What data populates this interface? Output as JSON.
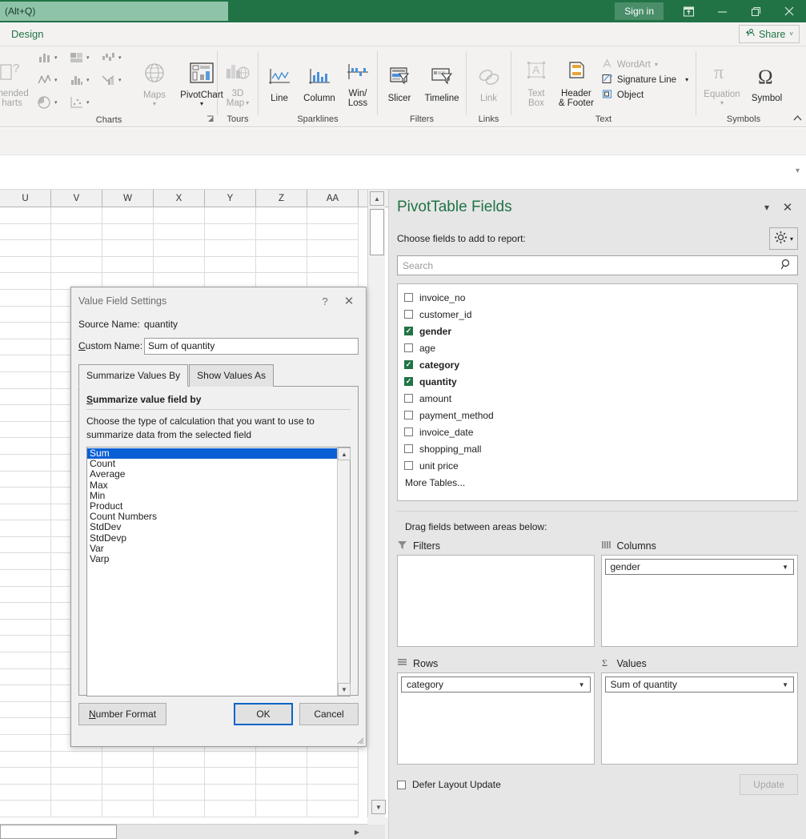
{
  "titlebar": {
    "search_placeholder": "(Alt+Q)",
    "signin_label": "Sign in",
    "ribbon_display_icon": "ribbon-display-options-icon",
    "minimize_icon": "minimize-icon",
    "restore_icon": "restore-icon",
    "close_icon": "close-icon"
  },
  "tabrow": {
    "design_tab": "Design",
    "share_label": "Share",
    "share_icon": "share-person-icon",
    "share_caret": "˅"
  },
  "ribbon": {
    "collapse_icon": "collapse-ribbon-chevron-icon",
    "groups": [
      {
        "label": "Charts",
        "recommended_label": "mended",
        "recommended_label2": "harts",
        "maps_label": "Maps",
        "pivotchart_label": "PivotChart",
        "launcher_icon": "dialog-box-launcher-icon",
        "small_icons": [
          "column-chart-icon",
          "hierarchy-chart-icon",
          "waterfall-chart-icon",
          "line-chart-icon",
          "statistic-chart-icon",
          "combo-chart-icon",
          "pie-chart-icon",
          "scatter-chart-icon"
        ]
      },
      {
        "label": "Tours",
        "map3d_label_line1": "3D",
        "map3d_label_line2": "Map",
        "map3d_icon": "3d-map-icon"
      },
      {
        "label": "Sparklines",
        "items": [
          {
            "label": "Line",
            "icon": "sparkline-line-icon"
          },
          {
            "label": "Column",
            "icon": "sparkline-column-icon"
          },
          {
            "label": "Win/\nLoss",
            "icon": "sparkline-winloss-icon"
          }
        ]
      },
      {
        "label": "Filters",
        "items": [
          {
            "label": "Slicer",
            "icon": "slicer-icon"
          },
          {
            "label": "Timeline",
            "icon": "timeline-icon"
          }
        ]
      },
      {
        "label": "Links",
        "items": [
          {
            "label": "Link",
            "icon": "link-icon"
          }
        ]
      },
      {
        "label": "Text",
        "textbox_line1": "Text",
        "textbox_line2": "Box",
        "header_line1": "Header",
        "header_line2": "& Footer",
        "wordart_label": "WordArt",
        "signature_label": "Signature Line",
        "object_label": "Object"
      },
      {
        "label": "Symbols",
        "equation_label": "Equation",
        "symbol_label": "Symbol"
      }
    ]
  },
  "sheet": {
    "columns": [
      "U",
      "V",
      "W",
      "X",
      "Y",
      "Z",
      "AA"
    ],
    "row_count": 38,
    "vscroll_up_icon": "scroll-up-arrow-icon",
    "vscroll_down_icon": "scroll-down-arrow-icon",
    "hscroll_right_icon": "scroll-right-arrow-icon",
    "formula_collapse_icon": "expand-formula-bar-icon"
  },
  "pane": {
    "title": "PivotTable Fields",
    "menu_caret": "▾",
    "close": "✕",
    "choose_label": "Choose fields to add to report:",
    "tools_icon": "gear-icon",
    "tools_caret": "▾",
    "search_placeholder": "Search",
    "search_icon": "search-icon",
    "fields": [
      {
        "label": "invoice_no",
        "checked": false
      },
      {
        "label": "customer_id",
        "checked": false
      },
      {
        "label": "gender",
        "checked": true
      },
      {
        "label": "age",
        "checked": false
      },
      {
        "label": "category",
        "checked": true
      },
      {
        "label": "quantity",
        "checked": true
      },
      {
        "label": "amount",
        "checked": false
      },
      {
        "label": "payment_method",
        "checked": false
      },
      {
        "label": "invoice_date",
        "checked": false
      },
      {
        "label": "shopping_mall",
        "checked": false
      },
      {
        "label": "unit price",
        "checked": false
      }
    ],
    "more_tables": "More Tables...",
    "drag_label": "Drag fields between areas below:",
    "areas": {
      "filters": {
        "label": "Filters",
        "icon": "filter-funnel-icon",
        "items": []
      },
      "columns": {
        "label": "Columns",
        "icon": "columns-icon",
        "items": [
          "gender"
        ]
      },
      "rows": {
        "label": "Rows",
        "icon": "rows-icon",
        "items": [
          "category"
        ]
      },
      "values": {
        "label": "Values",
        "icon": "sigma-icon",
        "items": [
          "Sum of quantity"
        ]
      }
    },
    "defer_label": "Defer Layout Update",
    "update_label": "Update"
  },
  "dialog": {
    "title": "Value Field Settings",
    "help_icon": "help-question-icon",
    "close_icon": "close-icon",
    "source_name_label": "Source Name:",
    "source_name_value": "quantity",
    "custom_name_label_u": "C",
    "custom_name_label_rest": "ustom Name:",
    "custom_name_value": "Sum of quantity",
    "tab_summarize": "Summarize Values By",
    "tab_showvalues": "Show Values As",
    "panel_heading_u": "S",
    "panel_heading_rest": "ummarize value field by",
    "panel_desc": "Choose the type of calculation that you want to use to summarize data from the selected field",
    "functions": [
      "Sum",
      "Count",
      "Average",
      "Max",
      "Min",
      "Product",
      "Count Numbers",
      "StdDev",
      "StdDevp",
      "Var",
      "Varp"
    ],
    "selected_function": "Sum",
    "number_format_u": "N",
    "number_format_rest": "umber Format",
    "ok_label": "OK",
    "cancel_label": "Cancel"
  },
  "colors": {
    "excel_green": "#217346",
    "selection_blue": "#0a5fd4",
    "default_btn_border": "#0a64c8"
  }
}
